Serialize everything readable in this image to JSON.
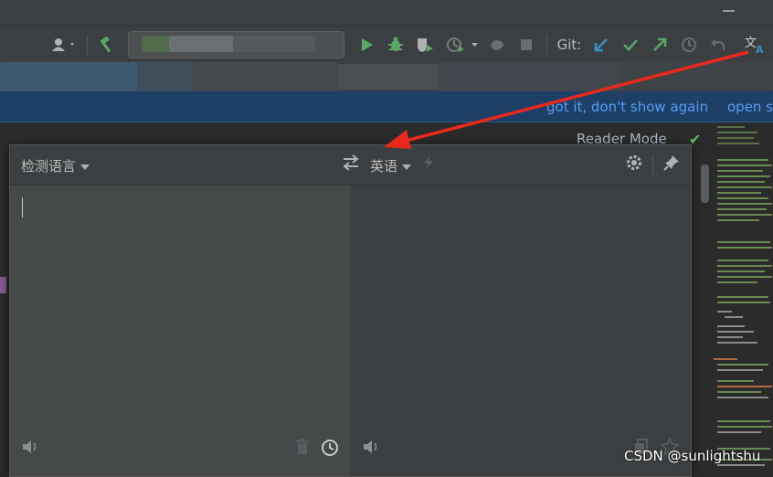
{
  "toolbar": {
    "git_label": "Git:"
  },
  "banner": {
    "got_it_link": "got it, don't show again",
    "open_link": "open s"
  },
  "editor": {
    "reader_mode": "Reader Mode"
  },
  "translator": {
    "source_language": "检测语言",
    "target_language": "英语",
    "input_text": ""
  },
  "watermark": "CSDN @sunlightshu",
  "icons": {
    "user": "user-icon",
    "build": "hammer-icon",
    "run": "run-icon",
    "debug": "debug-icon",
    "coverage": "coverage-icon",
    "profile": "profile-icon",
    "attach": "attach-icon",
    "stop": "stop-icon",
    "git_update": "git-update-icon",
    "git_commit": "git-commit-icon",
    "git_push": "git-push-icon",
    "git_history": "history-icon",
    "git_rollback": "rollback-icon",
    "translate": "translate-icon",
    "swap": "swap-languages-icon",
    "settings": "gear-icon",
    "pin": "pin-icon",
    "speaker": "speaker-icon",
    "trash": "trash-icon",
    "copy": "copy-icon",
    "star": "star-icon"
  },
  "colors": {
    "background": "#2b2b2b",
    "toolbar": "#3c3f41",
    "banner": "#1e3f66",
    "link": "#589df6",
    "run_green": "#59a869",
    "git_blue": "#3592c4",
    "annotation_red": "#e8291c"
  }
}
